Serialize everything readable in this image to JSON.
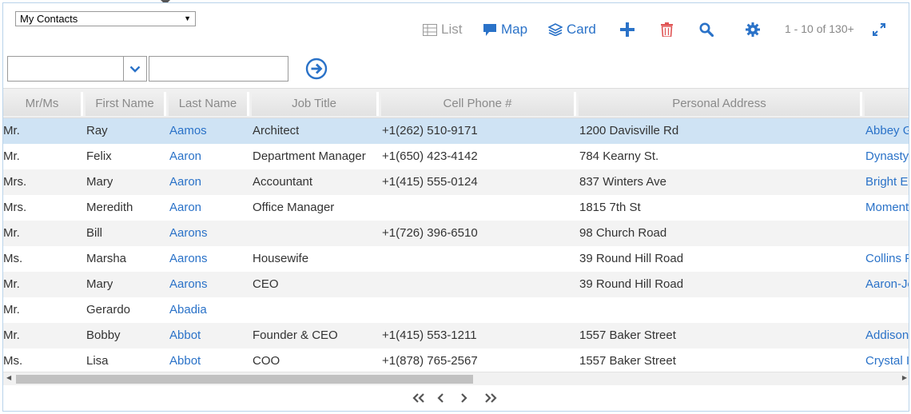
{
  "view_selector": {
    "value": "My Contacts"
  },
  "toolbar": {
    "list_label": "List",
    "map_label": "Map",
    "card_label": "Card",
    "page_count": "1 - 10 of 130+"
  },
  "colors": {
    "accent": "#2a72c8",
    "delete": "#e05555",
    "selected_row": "#cfe3f4",
    "alt_row": "#f3f3f3"
  },
  "grid": {
    "columns": [
      "Mr/Ms",
      "First Name",
      "Last Name",
      "Job Title",
      "Cell Phone #",
      "Personal Address",
      ""
    ],
    "rows": [
      {
        "mrms": "Mr.",
        "first": "Ray",
        "last": "Aamos",
        "job": "Architect",
        "phone": "+1(262) 510-9171",
        "address": "1200 Davisville Rd",
        "company": "Abbey G"
      },
      {
        "mrms": "Mr.",
        "first": "Felix",
        "last": "Aaron",
        "job": "Department Manager",
        "phone": "+1(650) 423-4142",
        "address": "784 Kearny St.",
        "company": "Dynasty"
      },
      {
        "mrms": "Mrs.",
        "first": "Mary",
        "last": "Aaron",
        "job": "Accountant",
        "phone": "+1(415) 555-0124",
        "address": "837 Winters Ave",
        "company": "Bright E"
      },
      {
        "mrms": "Mrs.",
        "first": "Meredith",
        "last": "Aaron",
        "job": "Office Manager",
        "phone": "",
        "address": "1815 7th St",
        "company": "Moment"
      },
      {
        "mrms": "Mr.",
        "first": "Bill",
        "last": "Aarons",
        "job": "",
        "phone": "+1(726) 396-6510",
        "address": "98 Church Road",
        "company": ""
      },
      {
        "mrms": "Ms.",
        "first": "Marsha",
        "last": "Aarons",
        "job": "Housewife",
        "phone": "",
        "address": "39 Round Hill Road",
        "company": "Collins F"
      },
      {
        "mrms": "Mr.",
        "first": "Mary",
        "last": "Aarons",
        "job": "CEO",
        "phone": "",
        "address": "39 Round Hill Road",
        "company": "Aaron-Jo"
      },
      {
        "mrms": "Mr.",
        "first": "Gerardo",
        "last": "Abadia",
        "job": "",
        "phone": "",
        "address": "",
        "company": ""
      },
      {
        "mrms": "Mr.",
        "first": "Bobby",
        "last": "Abbot",
        "job": "Founder & CEO",
        "phone": "+1(415) 553-1211",
        "address": "1557 Baker Street",
        "company": "Addison"
      },
      {
        "mrms": "Ms.",
        "first": "Lisa",
        "last": "Abbot",
        "job": "COO",
        "phone": "+1(878) 765-2567",
        "address": "1557 Baker Street",
        "company": "Crystal I"
      }
    ]
  }
}
